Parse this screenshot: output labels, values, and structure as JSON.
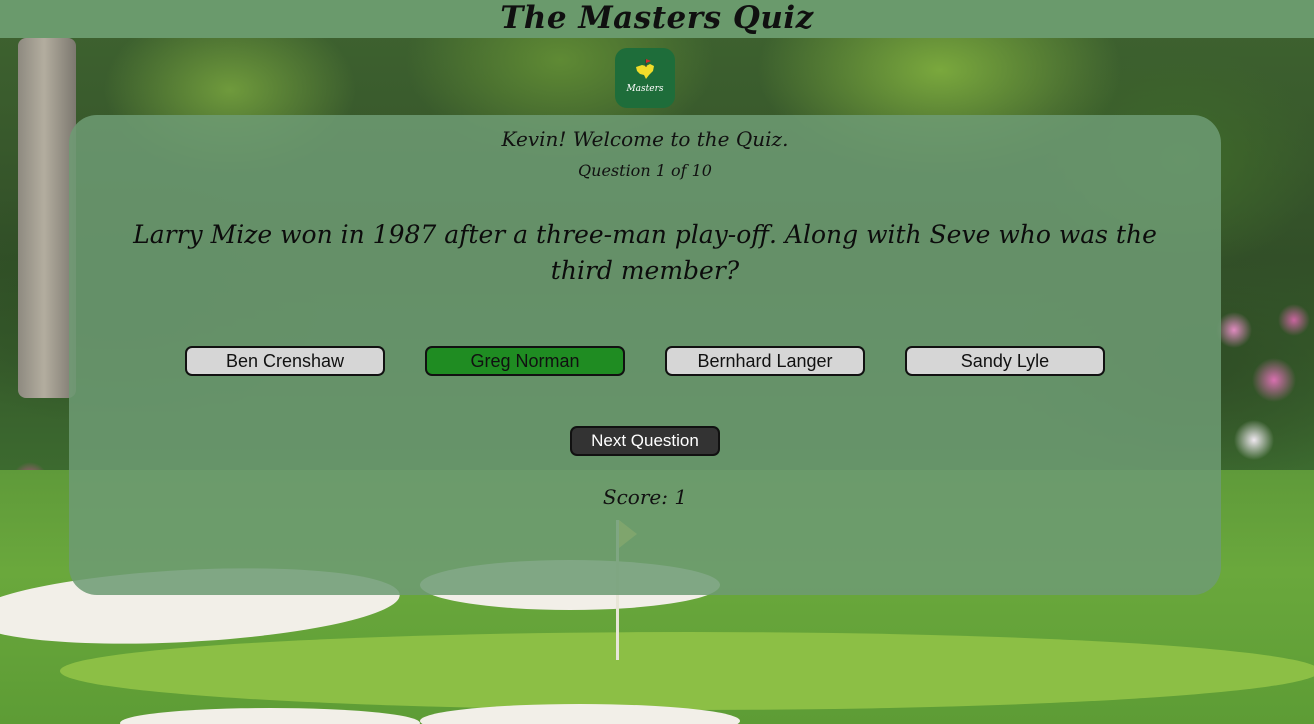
{
  "header": {
    "title": "The Masters Quiz"
  },
  "logo": {
    "text": "Masters",
    "icon": "masters-map-flag-icon"
  },
  "quiz": {
    "welcome": "Kevin! Welcome to the Quiz.",
    "progress": "Question 1 of 10",
    "question": "Larry Mize won in 1987 after a three-man play-off. Along with Seve who was the third member?",
    "answers": [
      {
        "label": "Ben Crenshaw",
        "state": "default"
      },
      {
        "label": "Greg Norman",
        "state": "correct"
      },
      {
        "label": "Bernhard Langer",
        "state": "default"
      },
      {
        "label": "Sandy Lyle",
        "state": "default"
      }
    ],
    "next_label": "Next Question",
    "score": "Score: 1"
  },
  "colors": {
    "header_bg": "#6a9a6c",
    "panel_bg": "#6e9b73",
    "correct_answer": "#1f8c22",
    "answer_default": "#d6d6d6",
    "next_button": "#333333",
    "logo_bg": "#1e6d3a"
  }
}
